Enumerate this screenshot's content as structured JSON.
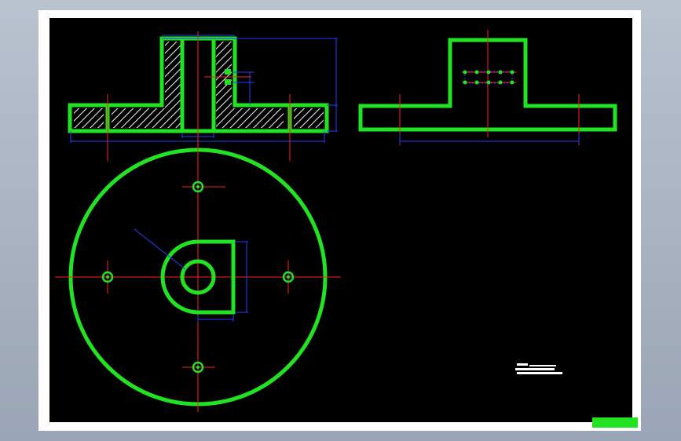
{
  "colors": {
    "background": "#9aa5b5",
    "sheet": "#ffffff",
    "canvas": "#000000",
    "outline": "#21e321",
    "centerline": "#ff2020",
    "dimension": "#2a3cff",
    "hatch": "#e8e8e8"
  },
  "views": {
    "front_section": "section-view",
    "side": "side-view",
    "top": "top-view"
  },
  "notes": {
    "line1": "",
    "line2": ""
  },
  "title_badge": ""
}
